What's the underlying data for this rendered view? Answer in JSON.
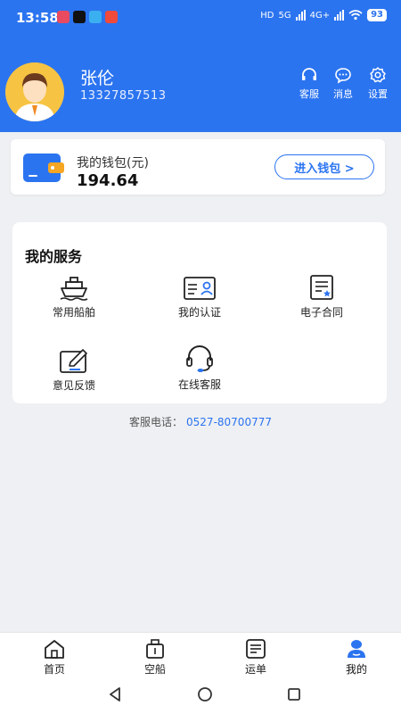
{
  "status": {
    "time": "13:58",
    "network_a": "HD",
    "network_b": "5G",
    "network_c": "4G+",
    "battery": "93"
  },
  "user": {
    "name": "张伦",
    "phone": "13327857513"
  },
  "top_actions": [
    {
      "label": "客服",
      "icon": "headset-icon"
    },
    {
      "label": "消息",
      "icon": "chat-bubble-icon"
    },
    {
      "label": "设置",
      "icon": "gear-icon"
    }
  ],
  "wallet": {
    "title": "我的钱包(元)",
    "amount": "194.64",
    "button_label": "进入钱包 >"
  },
  "services": {
    "title": "我的服务",
    "items": [
      {
        "label": "常用船舶",
        "icon": "ship-icon"
      },
      {
        "label": "我的认证",
        "icon": "id-card-icon"
      },
      {
        "label": "电子合同",
        "icon": "contract-icon"
      },
      {
        "label": "意见反馈",
        "icon": "edit-icon"
      },
      {
        "label": "在线客服",
        "icon": "headset-icon"
      }
    ]
  },
  "hotline": {
    "label": "客服电话：",
    "number": "0527-80700777"
  },
  "tabbar": {
    "items": [
      {
        "label": "首页",
        "icon": "home-icon",
        "active": false
      },
      {
        "label": "空船",
        "icon": "empty-ship-icon",
        "active": false
      },
      {
        "label": "运单",
        "icon": "waybill-icon",
        "active": false
      },
      {
        "label": "我的",
        "icon": "profile-icon",
        "active": true
      }
    ]
  },
  "colors": {
    "primary": "#2b74f0",
    "background": "#eef0f3",
    "avatar_bg": "#f6c343"
  }
}
